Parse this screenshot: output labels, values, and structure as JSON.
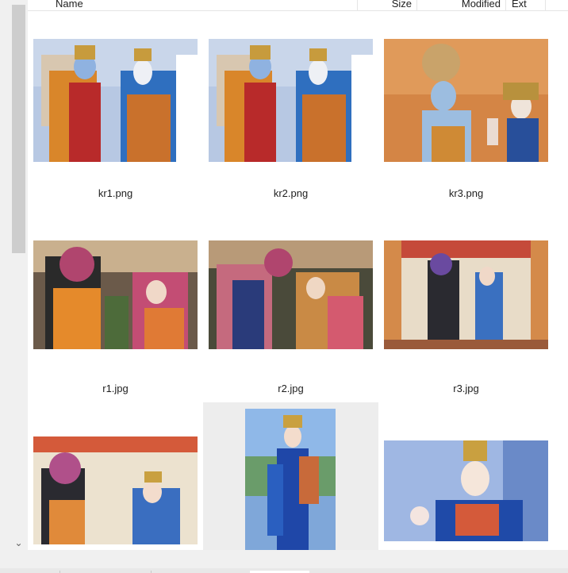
{
  "columns": {
    "name": "Name",
    "size": "Size",
    "modified": "Modified",
    "ext": "Ext"
  },
  "files": [
    {
      "label": "kr1.png"
    },
    {
      "label": "kr2.png"
    },
    {
      "label": "kr3.png"
    },
    {
      "label": "r1.jpg"
    },
    {
      "label": "r2.jpg"
    },
    {
      "label": "r3.jpg"
    },
    {
      "label": ""
    },
    {
      "label": ""
    },
    {
      "label": ""
    }
  ],
  "scrollbar": {
    "down_arrow": "⌄"
  }
}
